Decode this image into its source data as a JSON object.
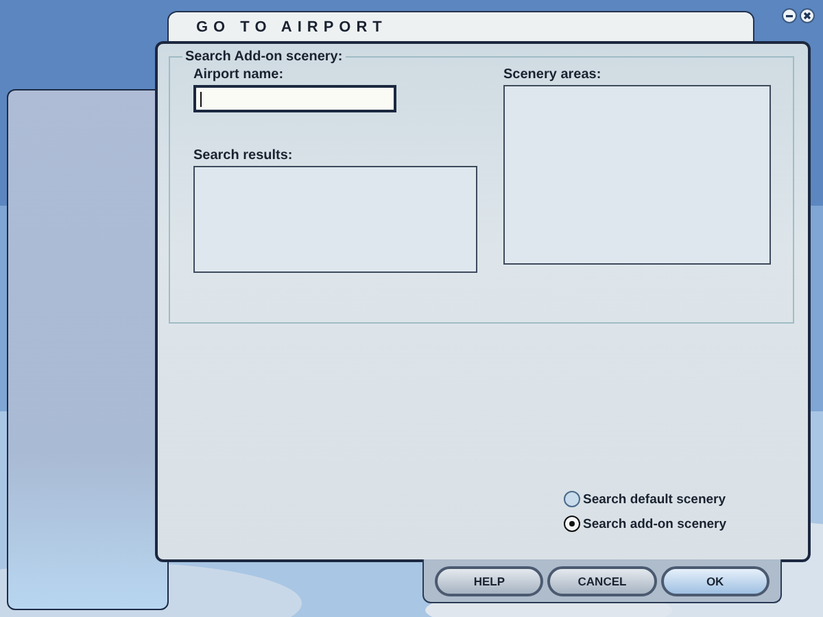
{
  "window": {
    "title": "GO TO AIRPORT"
  },
  "search_group": {
    "legend": "Search Add-on scenery:",
    "airport_name": {
      "label": "Airport name:",
      "focused": true
    },
    "search_results": {
      "label": "Search results:"
    },
    "scenery_areas": {
      "label": "Scenery areas:"
    }
  },
  "scenery_options": [
    {
      "label": "Search default scenery",
      "selected": false
    },
    {
      "label": "Search add-on scenery",
      "selected": true
    }
  ],
  "buttons": [
    {
      "label": "HELP",
      "kind": "normal"
    },
    {
      "label": "CANCEL",
      "kind": "normal"
    },
    {
      "label": "OK",
      "kind": "default"
    }
  ]
}
